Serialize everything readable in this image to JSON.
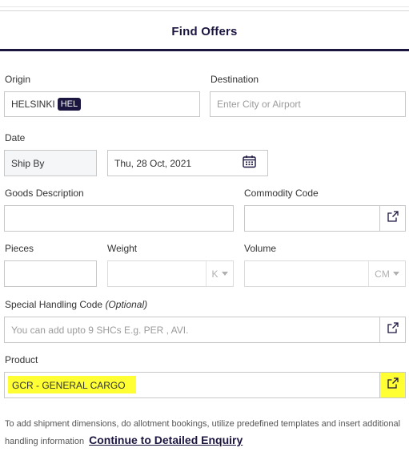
{
  "header": {
    "title": "Find Offers"
  },
  "origin": {
    "label": "Origin",
    "city": "HELSINKI",
    "code": "HEL"
  },
  "destination": {
    "label": "Destination",
    "placeholder": "Enter City or Airport"
  },
  "date": {
    "label": "Date",
    "mode": "Ship By",
    "value": "Thu, 28 Oct, 2021",
    "icon": "calendar-icon"
  },
  "goods": {
    "label": "Goods Description",
    "value": ""
  },
  "commodity": {
    "label": "Commodity Code",
    "value": "",
    "icon": "external-link-icon"
  },
  "pieces": {
    "label": "Pieces",
    "value": ""
  },
  "weight": {
    "label": "Weight",
    "unit": "K"
  },
  "volume": {
    "label": "Volume",
    "unit": "CM"
  },
  "shc": {
    "label": "Special Handling Code",
    "label_optional": "(Optional)",
    "placeholder": "You can add upto 9 SHCs  E.g. PER , AVI.",
    "icon": "external-link-icon"
  },
  "product": {
    "label": "Product",
    "value": "GCR - GENERAL CARGO",
    "icon": "external-link-icon",
    "highlight_color": "#ffff33"
  },
  "footer": {
    "text": "To add shipment dimensions, do allotment bookings, utilize predefined templates and insert additional handling information",
    "link": "Continue to Detailed Enquiry"
  },
  "colors": {
    "accent": "#1b1640",
    "border": "#c8c8c8",
    "highlight": "#ffff33"
  }
}
